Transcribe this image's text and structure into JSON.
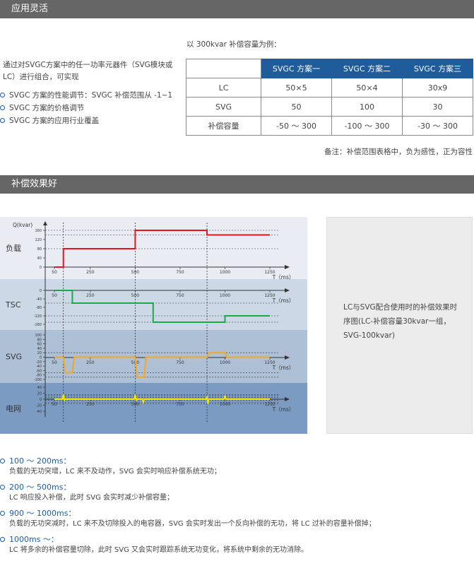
{
  "sections": {
    "s1_title": "应用灵活",
    "s2_title": "补偿效果好"
  },
  "intro": "通过对SVGC方案中的任一功率元器件（SVG模块或LC）进行组合，可实现",
  "bullets": [
    "SVGC 方案的性能调节：SVGC 补偿范围从 -1~1",
    "SVGC 方案的价格调节",
    "SVGC 方案的应用行业覆盖"
  ],
  "example": "以 300kvar 补偿容量为例：",
  "table": {
    "headers": [
      "SVGC 方案一",
      "SVGC 方案二",
      "SVGC 方案三"
    ],
    "rows": [
      {
        "label": "LC",
        "values": [
          "50×5",
          "50×4",
          "30x9"
        ]
      },
      {
        "label": "SVG",
        "values": [
          "50",
          "100",
          "30"
        ]
      },
      {
        "label": "补偿容量",
        "values": [
          "-50 ～ 300",
          "-100 ～ 300",
          "-30 ～ 300"
        ]
      }
    ]
  },
  "note": "备注：补偿范围表格中，负为感性，正为容性",
  "chart_data": {
    "type": "line",
    "ylabel": "Q(kvar)",
    "xlabel": "T（ms）",
    "x_ticks": [
      50,
      250,
      500,
      750,
      1000,
      1250
    ],
    "panels": [
      {
        "name": "负载",
        "color": "#e8141c",
        "yticks": [
          0,
          40,
          80,
          120,
          160
        ],
        "ylim": [
          0,
          160
        ],
        "points": [
          [
            50,
            0
          ],
          [
            100,
            0
          ],
          [
            100,
            80
          ],
          [
            500,
            80
          ],
          [
            500,
            160
          ],
          [
            900,
            160
          ],
          [
            900,
            140
          ],
          [
            1250,
            140
          ]
        ]
      },
      {
        "name": "TSC",
        "color": "#1aa84a",
        "yticks": [
          0,
          -40,
          -80,
          -120,
          -160
        ],
        "ylim": [
          -160,
          0
        ],
        "points": [
          [
            50,
            0
          ],
          [
            150,
            0
          ],
          [
            150,
            -60
          ],
          [
            600,
            -60
          ],
          [
            600,
            -150
          ],
          [
            1000,
            -150
          ],
          [
            1000,
            -120
          ],
          [
            1250,
            -120
          ]
        ]
      },
      {
        "name": "SVG",
        "color": "#f5a623",
        "yticks": [
          100,
          80,
          60,
          40,
          20,
          0,
          -20,
          -40,
          -60,
          -80,
          -100
        ],
        "ylim": [
          -100,
          100
        ],
        "points": [
          [
            50,
            0
          ],
          [
            100,
            0
          ],
          [
            110,
            -70
          ],
          [
            150,
            -70
          ],
          [
            160,
            0
          ],
          [
            500,
            0
          ],
          [
            510,
            -90
          ],
          [
            550,
            -90
          ],
          [
            560,
            0
          ],
          [
            900,
            0
          ],
          [
            910,
            20
          ],
          [
            1000,
            20
          ],
          [
            1010,
            0
          ],
          [
            1250,
            0
          ]
        ]
      },
      {
        "name": "电网",
        "color": "#f5e400",
        "yticks": [
          40,
          20,
          0,
          -20,
          -40
        ],
        "ylim": [
          -40,
          40
        ],
        "points": [
          [
            50,
            0
          ],
          [
            95,
            0
          ],
          [
            100,
            15
          ],
          [
            105,
            -3
          ],
          [
            110,
            0
          ],
          [
            495,
            0
          ],
          [
            500,
            15
          ],
          [
            505,
            -3
          ],
          [
            510,
            0
          ],
          [
            540,
            0
          ],
          [
            545,
            -10
          ],
          [
            550,
            0
          ],
          [
            895,
            0
          ],
          [
            900,
            6
          ],
          [
            905,
            -15
          ],
          [
            910,
            0
          ],
          [
            995,
            0
          ],
          [
            1000,
            12
          ],
          [
            1005,
            0
          ],
          [
            1250,
            0
          ]
        ]
      }
    ]
  },
  "side_text": "LC与SVG配合使用时的补偿效果时序图(LC-补偿容量30kvar一组，SVG-100kvar)",
  "timeline": [
    {
      "head": "100 ～ 200ms：",
      "desc": "负载的无功突增，LC 来不及动作，SVG 会实时响应补偿系统无功；"
    },
    {
      "head": "200 ～ 500ms：",
      "desc": "LC 响应投入补偿，此时 SVG 会实时减少补偿容量；"
    },
    {
      "head": "900 ～ 1000ms：",
      "desc": "负载的无功突减时，LC 来不及切除投入的电容器，SVG 会实时发出一个反向补偿的无功，将 LC 过补的容量补偿掉；"
    },
    {
      "head": "1000ms ～：",
      "desc": "LC 将多余的补偿容量切除，此时 SVG 又会实时跟踪系统无功变化，将系统中剩余的无功消除。"
    }
  ]
}
